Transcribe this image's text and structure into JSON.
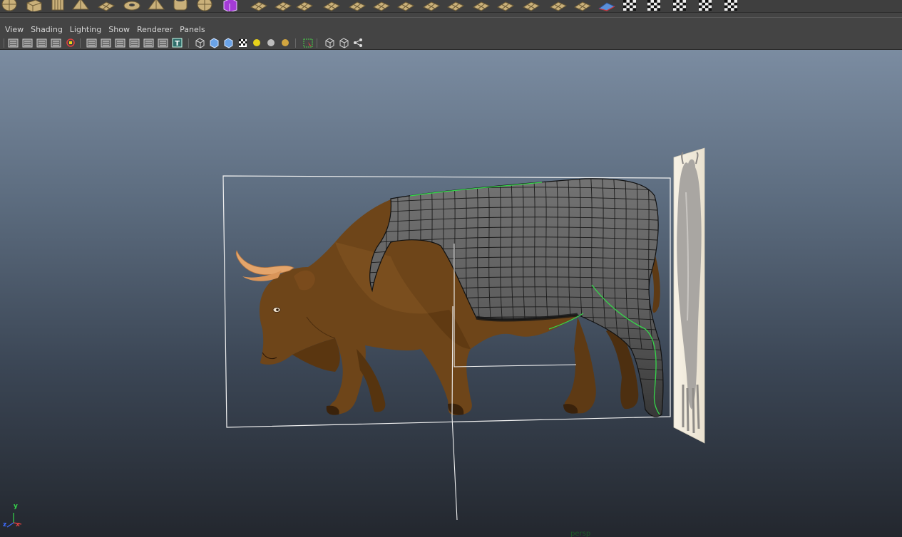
{
  "shelf": {
    "icons": [
      "poly-sphere-icon",
      "poly-cube-icon",
      "poly-cylinder-icon",
      "poly-cone-icon",
      "poly-plane-icon",
      "poly-torus-icon",
      "poly-pyramid-icon",
      "poly-pipe-icon",
      "soccer-ball-icon",
      "combine-icon",
      "separate-icon",
      "smooth-icon",
      "sculpt-geometry-icon",
      "extrude-icon",
      "bridge-icon",
      "append-polygon-icon",
      "split-polygon-icon",
      "insert-edge-loop-icon",
      "offset-edge-loop-icon",
      "merge-vertices-icon",
      "bevel-icon",
      "wedge-icon",
      "poke-icon",
      "fill-hole-icon",
      "uv-editor-icon",
      "planar-mapping-icon",
      "cylindrical-mapping-icon",
      "spherical-mapping-icon",
      "automatic-mapping-icon",
      "checker-map-icon"
    ]
  },
  "panel_menu": {
    "items": [
      "View",
      "Shading",
      "Lighting",
      "Show",
      "Renderer",
      "Panels"
    ]
  },
  "panel_toolbar": {
    "icons": [
      "select-camera-icon",
      "camera-attributes-icon",
      "bookmark-icon",
      "image-plane-icon",
      "camera-lock-icon",
      "grid-icon",
      "film-gate-icon",
      "resolution-gate-icon",
      "gate-mask-icon",
      "field-chart-icon",
      "safe-action-icon",
      "safe-title-icon",
      "wireframe-icon",
      "smooth-shade-icon",
      "wireframe-on-shaded-icon",
      "textured-icon",
      "use-all-lights-icon",
      "shadows-icon",
      "ambient-occlusion-icon",
      "isolate-select-icon",
      "xray-icon",
      "xray-joints-icon",
      "xray-components-icon"
    ]
  },
  "viewport": {
    "camera": "persp",
    "axis": {
      "x": "x",
      "y": "y",
      "z": "z"
    },
    "colors": {
      "bull_body": "#6e4519",
      "bull_shadow": "#4a2c0e",
      "horn": "#e4a56b",
      "mesh_fill": "#5b5b5b",
      "mesh_lines": "#1a1a1a",
      "selection_green": "#35d64a",
      "gate_line": "#f2f2f2",
      "reference_plane": "#f4eedf"
    }
  }
}
